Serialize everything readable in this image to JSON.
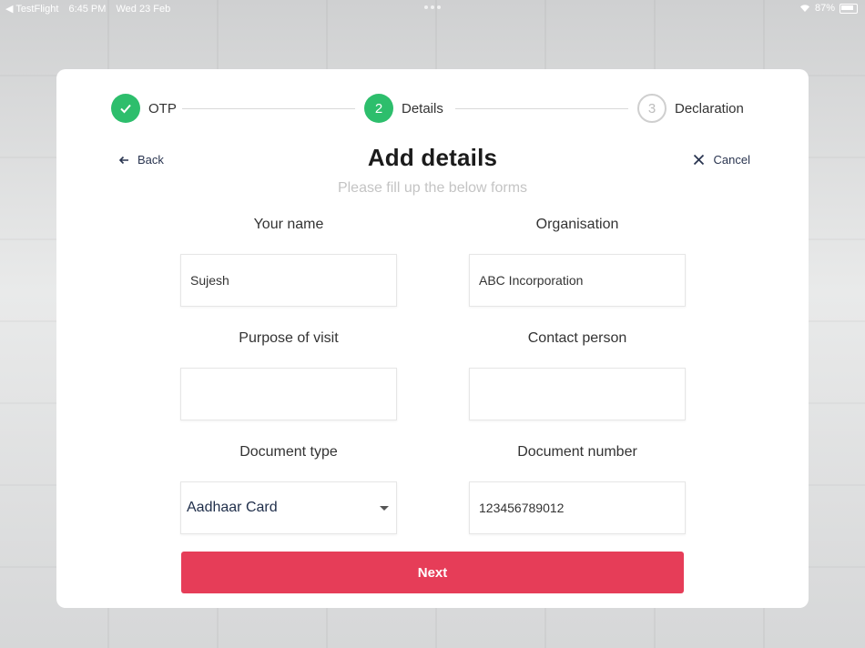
{
  "status_bar": {
    "app": "◀ TestFlight",
    "time": "6:45 PM",
    "date": "Wed 23 Feb",
    "battery": "87%"
  },
  "stepper": {
    "steps": [
      {
        "number": "",
        "label": "OTP",
        "state": "done"
      },
      {
        "number": "2",
        "label": "Details",
        "state": "active"
      },
      {
        "number": "3",
        "label": "Declaration",
        "state": "pending"
      }
    ]
  },
  "nav": {
    "back_label": "Back",
    "cancel_label": "Cancel"
  },
  "header": {
    "title": "Add details",
    "subtitle": "Please fill up the below forms"
  },
  "form": {
    "your_name": {
      "label": "Your name",
      "value": "Sujesh"
    },
    "organisation": {
      "label": "Organisation",
      "value": "ABC Incorporation"
    },
    "purpose": {
      "label": "Purpose of visit",
      "value": ""
    },
    "contact": {
      "label": "Contact person",
      "value": ""
    },
    "doc_type": {
      "label": "Document type",
      "value": "Aadhaar Card"
    },
    "doc_number": {
      "label": "Document number",
      "value": "123456789012"
    }
  },
  "next_label": "Next",
  "colors": {
    "accent_green": "#2dbe6c",
    "primary_red": "#e63d58"
  }
}
